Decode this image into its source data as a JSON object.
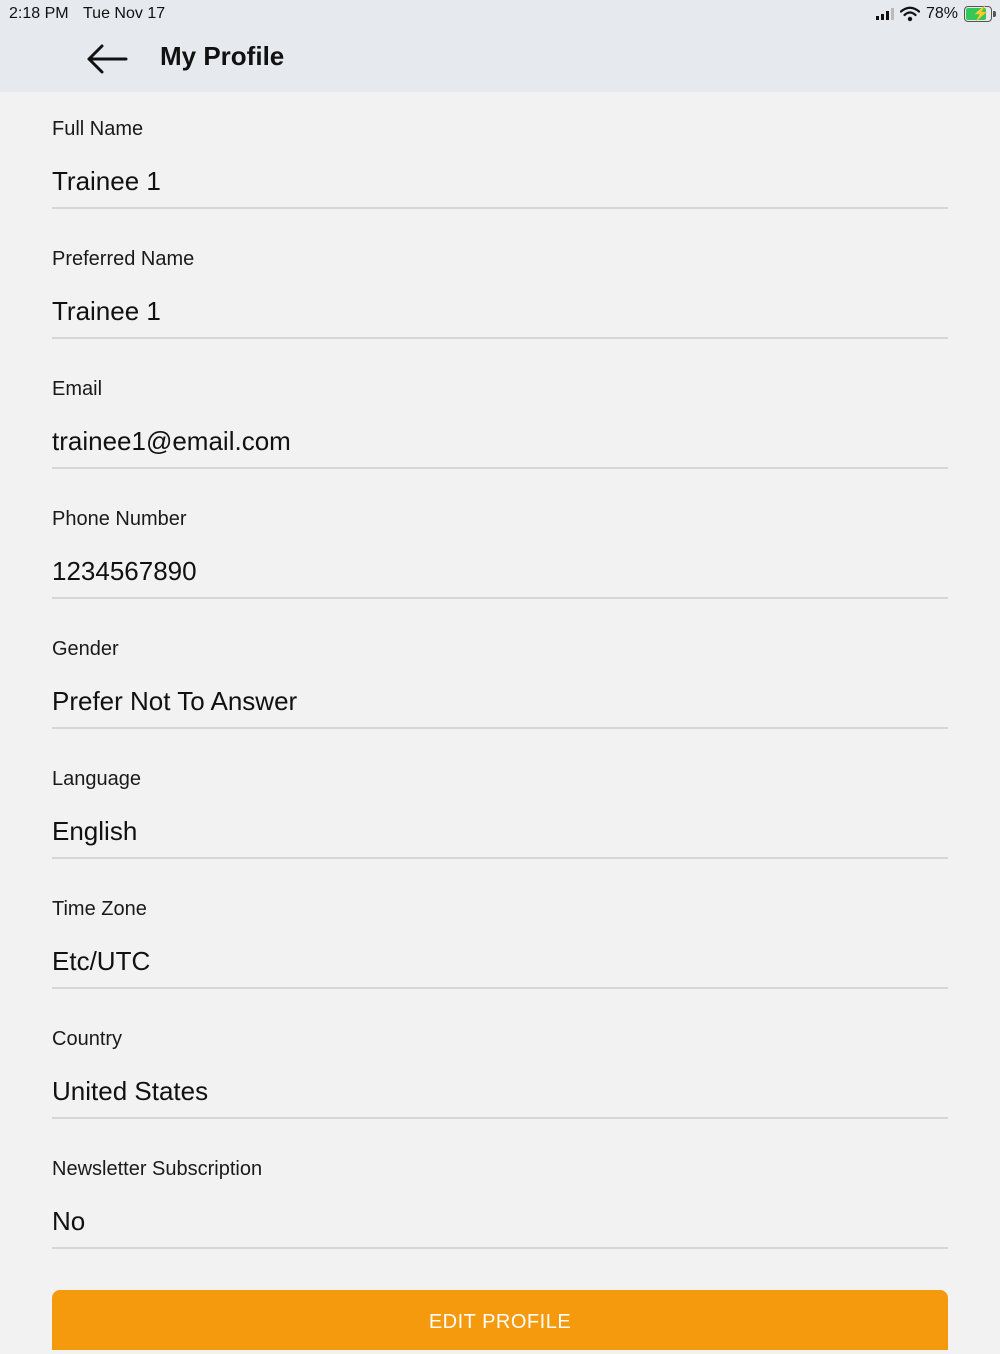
{
  "status_bar": {
    "time": "2:18 PM",
    "date": "Tue Nov 17",
    "battery_percent": "78%",
    "battery_level": 0.78,
    "icons": [
      "cellular-signal-icon",
      "wifi-icon",
      "battery-charging-icon"
    ]
  },
  "header": {
    "title": "My Profile",
    "back_icon": "arrow-left-icon"
  },
  "fields": [
    {
      "label": "Full Name",
      "value": "Trainee 1"
    },
    {
      "label": "Preferred Name",
      "value": "Trainee 1"
    },
    {
      "label": "Email",
      "value": "trainee1@email.com"
    },
    {
      "label": "Phone Number",
      "value": "1234567890"
    },
    {
      "label": "Gender",
      "value": "Prefer Not To Answer"
    },
    {
      "label": "Language",
      "value": "English"
    },
    {
      "label": "Time Zone",
      "value": "Etc/UTC"
    },
    {
      "label": "Country",
      "value": "United States"
    },
    {
      "label": "Newsletter Subscription",
      "value": "No"
    }
  ],
  "edit_button": {
    "label": "EDIT PROFILE"
  },
  "colors": {
    "header_bg": "#e6eaef",
    "page_bg": "#f2f2f2",
    "accent": "#f59a0c",
    "battery_green": "#34c759"
  }
}
